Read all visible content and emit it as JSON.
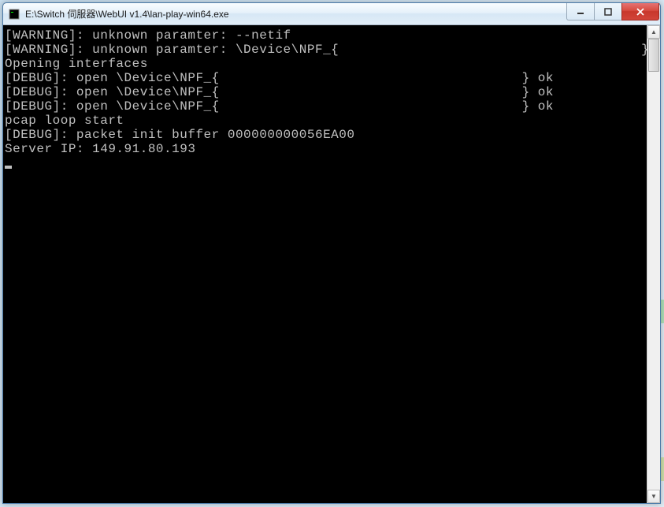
{
  "window": {
    "title": "E:\\Switch 伺服器\\WebUI v1.4\\lan-play-win64.exe"
  },
  "console": {
    "lines": [
      "[WARNING]: unknown paramter: --netif",
      "[WARNING]: unknown paramter: \\Device\\NPF_{                                      }",
      "Opening interfaces",
      "[DEBUG]: open \\Device\\NPF_{                                      } ok",
      "[DEBUG]: open \\Device\\NPF_{                                      } ok",
      "[DEBUG]: open \\Device\\NPF_{                                      } ok",
      "pcap loop start",
      "[DEBUG]: packet init buffer 000000000056EA00",
      "Server IP: 149.91.80.193"
    ]
  }
}
